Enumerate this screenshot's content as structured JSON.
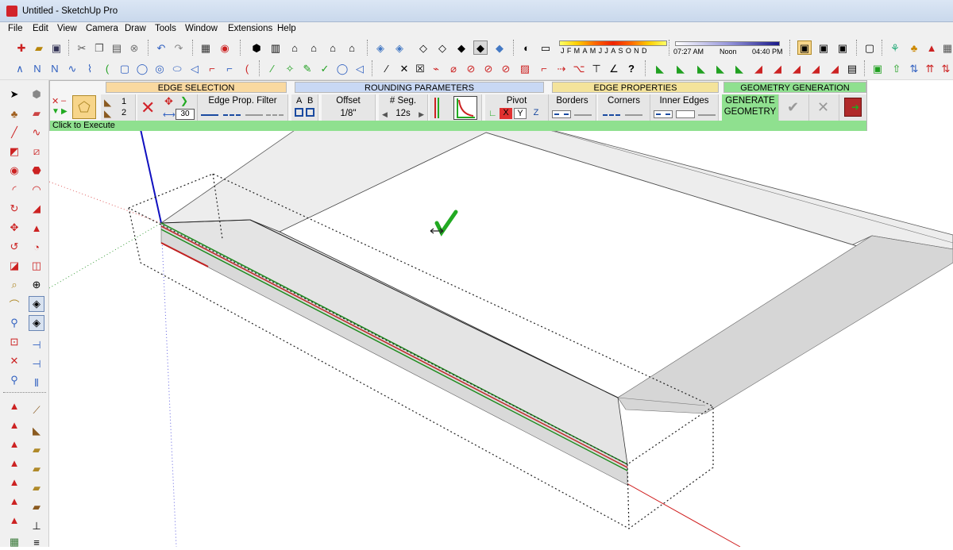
{
  "window": {
    "title": "Untitled - SketchUp Pro"
  },
  "menu": [
    "File",
    "Edit",
    "View",
    "Camera",
    "Draw",
    "Tools",
    "Window",
    "Extensions",
    "Help"
  ],
  "shadows": {
    "months": [
      "J",
      "F",
      "M",
      "A",
      "M",
      "J",
      "J",
      "A",
      "S",
      "O",
      "N",
      "D"
    ],
    "time_start": "07:27 AM",
    "time_mid": "Noon",
    "time_end": "04:40 PM"
  },
  "round_corner": {
    "sections": {
      "edge_selection": "EDGE SELECTION",
      "rounding_parameters": "ROUNDING PARAMETERS",
      "edge_properties": "EDGE PROPERTIES",
      "geometry_generation": "GEOMETRY GENERATION"
    },
    "option_1": "1",
    "option_2": "2",
    "angle_value": "30",
    "edge_prop_filter": "Edge Prop. Filter",
    "ab_a": "A",
    "ab_b": "B",
    "offset_label": "Offset",
    "offset_value": "1/8\"",
    "segments_label": "# Seg.",
    "segments_value": "12s",
    "pivot_label": "Pivot",
    "pivot_x": "X",
    "pivot_y": "Y",
    "pivot_z": "Z",
    "borders_label": "Borders",
    "corners_label": "Corners",
    "inner_edges_label": "Inner Edges",
    "generate_line1": "GENERATE",
    "generate_line2": "GEOMETRY",
    "status": "Click to Execute"
  },
  "colors": {
    "edge_selection": "#f9d9a0",
    "rounding_parameters": "#c8d8f4",
    "edge_properties": "#f4e39b",
    "geometry_generation": "#8fe08f",
    "status_bar": "#8fe08f",
    "selected_red": "#d2232a",
    "edge_green": "#1a8a1a"
  }
}
